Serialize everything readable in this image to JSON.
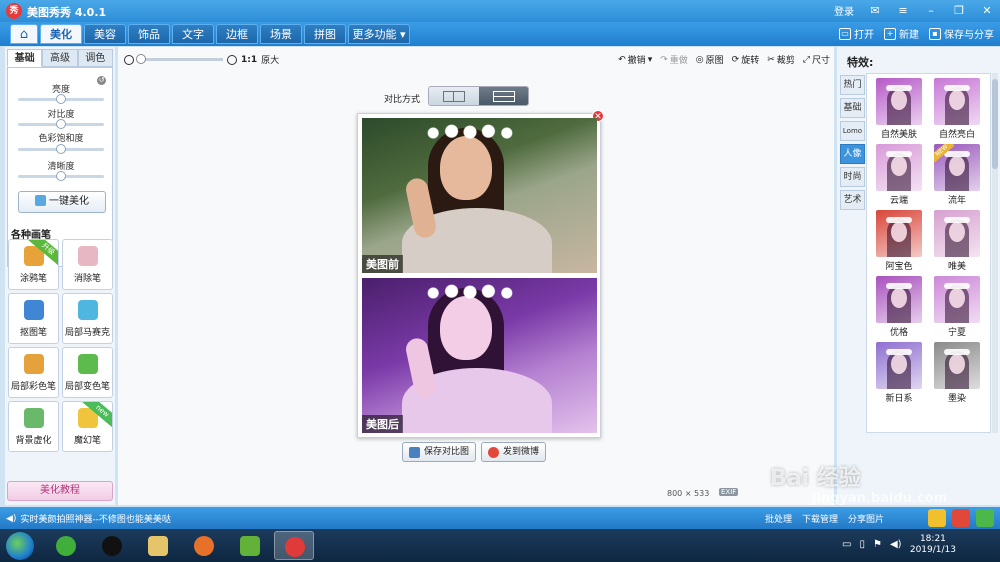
{
  "window": {
    "logo_text": "秀",
    "title": "美图秀秀 4.0.1",
    "login": "登录"
  },
  "menu": {
    "tabs": [
      "美化",
      "美容",
      "饰品",
      "文字",
      "边框",
      "场景",
      "拼图",
      "更多功能 ▾"
    ],
    "open": "打开",
    "new": "新建",
    "save_share": "保存与分享"
  },
  "left": {
    "subtabs": [
      "基础",
      "高级",
      "调色"
    ],
    "adjustments": [
      {
        "label": "亮度",
        "level": 0.5
      },
      {
        "label": "对比度",
        "level": 0.5
      },
      {
        "label": "色彩饱和度",
        "level": 0.5
      },
      {
        "label": "清晰度",
        "level": 0.5
      }
    ],
    "one_key": "一键美化",
    "brushes_title": "各种画笔",
    "brushes": [
      {
        "label": "涂鸦笔",
        "badge": "升级",
        "color": "#e7a23a"
      },
      {
        "label": "消除笔",
        "badge": "",
        "color": "#e7b7c3"
      },
      {
        "label": "抠图笔",
        "badge": "",
        "color": "#3f86d4"
      },
      {
        "label": "局部马赛克",
        "badge": "",
        "color": "#4fb6e0"
      },
      {
        "label": "局部彩色笔",
        "badge": "",
        "color": "#e5a13c"
      },
      {
        "label": "局部变色笔",
        "badge": "",
        "color": "#5cbb4c"
      },
      {
        "label": "背景虚化",
        "badge": "",
        "color": "#6ab86a"
      },
      {
        "label": "魔幻笔",
        "badge": "new",
        "color": "#f0c43d"
      }
    ],
    "tutorial": "美化教程"
  },
  "center": {
    "zoom_ratio": "1:1",
    "zoom_label": "原大",
    "tools": [
      "撤销",
      "重做",
      "原图",
      "旋转",
      "裁剪",
      "尺寸"
    ],
    "compare_label": "对比方式",
    "before_tag": "美图前",
    "after_tag": "美图后",
    "save_compare": "保存对比图",
    "send_weibo": "发到微博",
    "dimensions": "800 × 533",
    "exif": "EXIF"
  },
  "right": {
    "title": "特效:",
    "categories": [
      "热门",
      "基础",
      "Lomo",
      "人像",
      "时尚",
      "艺术"
    ],
    "active_category": "人像",
    "effects": [
      {
        "label": "自然美肤",
        "color": "#b55ac8"
      },
      {
        "label": "自然亮白",
        "color": "#c878d6"
      },
      {
        "label": "云端",
        "color": "#d89ad8"
      },
      {
        "label": "流年",
        "color": "#9a5bbd"
      },
      {
        "label": "阿宝色",
        "color": "#d8453a"
      },
      {
        "label": "唯美",
        "color": "#d7a0cf"
      },
      {
        "label": "优格",
        "color": "#a852bd"
      },
      {
        "label": "宁夏",
        "color": "#cc88d8"
      },
      {
        "label": "新日系",
        "color": "#8f6fd0"
      },
      {
        "label": "墨染",
        "color": "#8a8a8a"
      }
    ],
    "ribbon": "NEW"
  },
  "status": {
    "message": "实时美颜拍照神器--不修图也能美美哒",
    "batch": "批处理",
    "download": "下载管理",
    "share": "分享图片"
  },
  "taskbar": {
    "time": "18:21",
    "date": "2019/1/13"
  },
  "watermark": {
    "text": "Bai 经验",
    "url": "jingyan.baidu.com"
  },
  "colors": {
    "accent": "#2d8ed8",
    "active_category": "#3d94dd"
  }
}
